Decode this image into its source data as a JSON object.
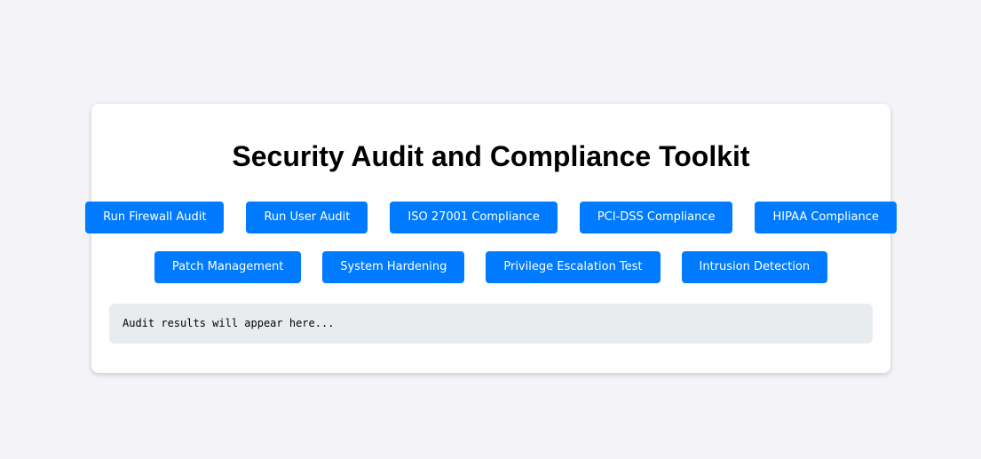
{
  "page": {
    "title": "Security Audit and Compliance Toolkit"
  },
  "buttons": {
    "row1": [
      {
        "label": "Run Firewall Audit"
      },
      {
        "label": "Run User Audit"
      },
      {
        "label": "ISO 27001 Compliance"
      },
      {
        "label": "PCI-DSS Compliance"
      },
      {
        "label": "HIPAA Compliance"
      }
    ],
    "row2": [
      {
        "label": "Patch Management"
      },
      {
        "label": "System Hardening"
      },
      {
        "label": "Privilege Escalation Test"
      },
      {
        "label": "Intrusion Detection"
      }
    ]
  },
  "output": {
    "text": "Audit results will appear here..."
  },
  "colors": {
    "background": "#f4f4f8",
    "card": "#ffffff",
    "button": "#007bff",
    "button_text": "#ffffff",
    "output_bg": "#e9ecef"
  }
}
